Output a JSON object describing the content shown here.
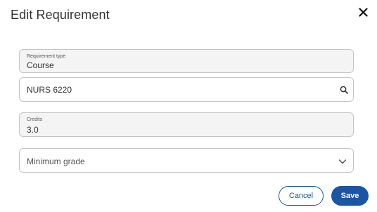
{
  "dialog": {
    "title": "Edit Requirement",
    "close_icon": "close-icon"
  },
  "fields": {
    "requirement_type": {
      "label": "Requirement type",
      "value": "Course"
    },
    "course_search": {
      "value": "NURS 6220",
      "icon": "search-icon"
    },
    "credits": {
      "label": "Credits",
      "value": "3.0"
    },
    "minimum_grade": {
      "placeholder": "Minimum grade",
      "icon": "chevron-down-icon"
    }
  },
  "actions": {
    "cancel_label": "Cancel",
    "save_label": "Save"
  },
  "colors": {
    "accent": "#1a56a5",
    "field_bg": "#f4f4f4",
    "border": "#c5c5c5"
  }
}
